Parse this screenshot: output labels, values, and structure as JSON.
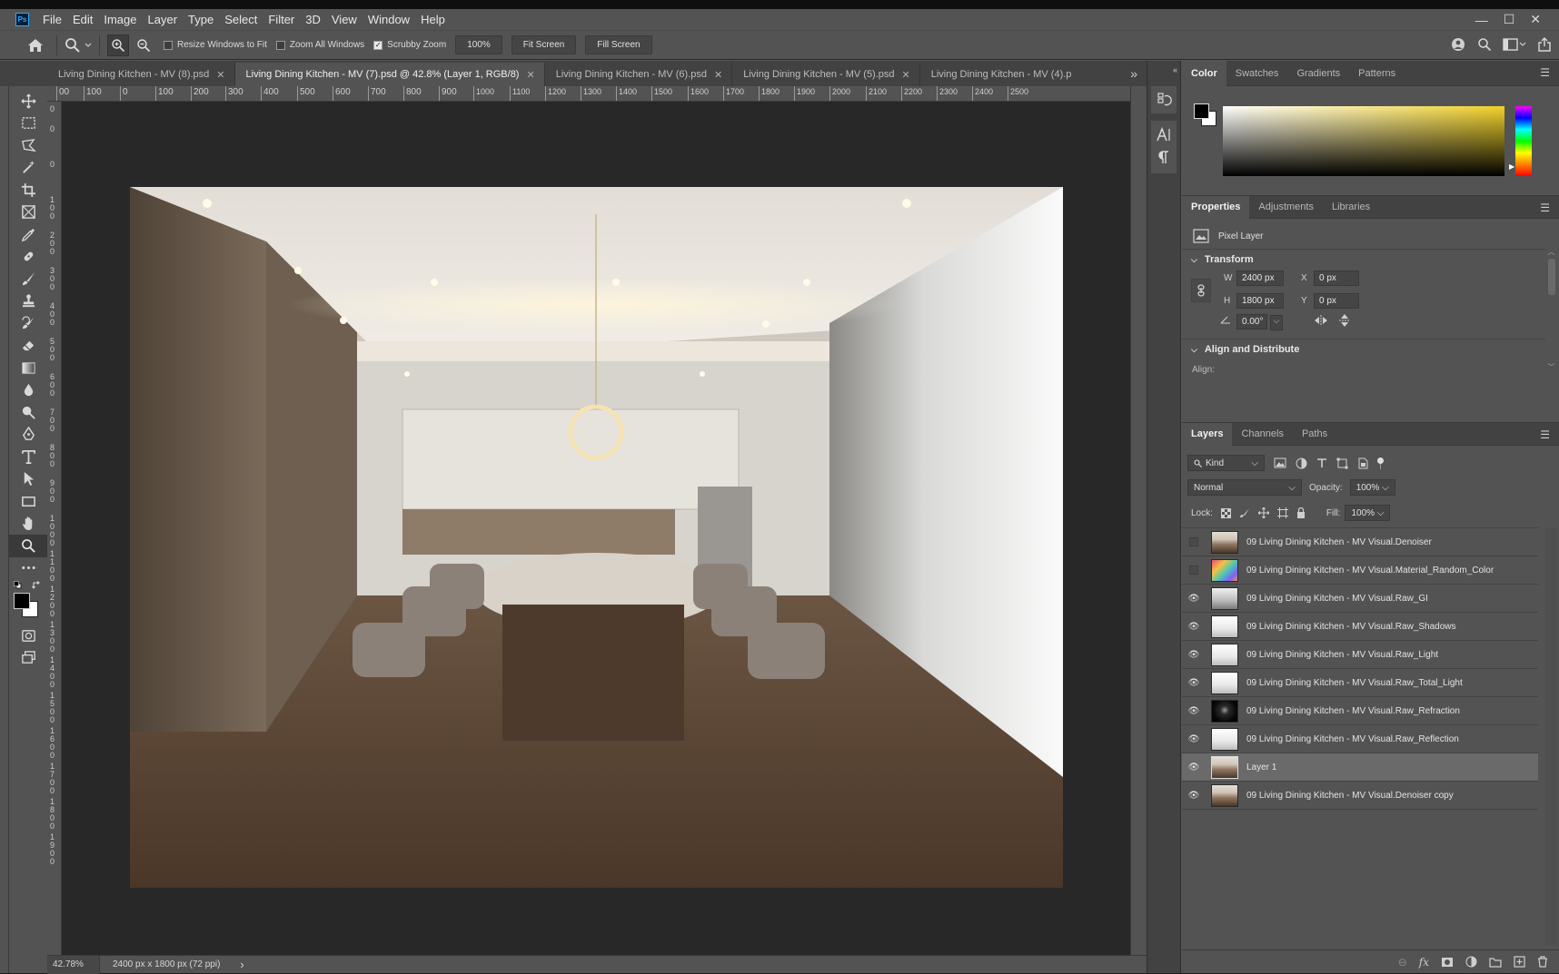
{
  "app": {
    "logo": "Ps",
    "menu": [
      "File",
      "Edit",
      "Image",
      "Layer",
      "Type",
      "Select",
      "Filter",
      "3D",
      "View",
      "Window",
      "Help"
    ],
    "window_controls": {
      "minimize": "—",
      "maximize": "☐",
      "close": "✕"
    }
  },
  "options_bar": {
    "resize_windows_label": "Resize Windows to Fit",
    "resize_windows_checked": false,
    "zoom_all_label": "Zoom All Windows",
    "zoom_all_checked": false,
    "scrubby_zoom_label": "Scrubby Zoom",
    "scrubby_zoom_checked": true,
    "zoom_percent": "100%",
    "fit_screen": "Fit Screen",
    "fill_screen": "Fill Screen"
  },
  "tabs": [
    {
      "label": "Living Dining Kitchen - MV (8).psd",
      "active": false,
      "closable": true
    },
    {
      "label": "Living Dining Kitchen - MV (7).psd @ 42.8% (Layer 1, RGB/8)",
      "active": true,
      "closable": true
    },
    {
      "label": "Living Dining Kitchen - MV (6).psd",
      "active": false,
      "closable": true
    },
    {
      "label": "Living Dining Kitchen - MV (5).psd",
      "active": false,
      "closable": true
    },
    {
      "label": "Living Dining Kitchen - MV (4).p",
      "active": false,
      "closable": false
    }
  ],
  "tabs_overflow": "»",
  "ruler": {
    "h_ticks": [
      "00",
      "100",
      "0",
      "100",
      "200",
      "300",
      "400",
      "500",
      "600",
      "700",
      "800",
      "900",
      "1000",
      "1100",
      "1200",
      "1300",
      "1400",
      "1500",
      "1600",
      "1700",
      "1800",
      "1900",
      "2000",
      "2100",
      "2200",
      "2300",
      "2400",
      "2500"
    ],
    "v_ticks": [
      "0",
      "0",
      "0",
      "100",
      "200",
      "300",
      "400",
      "500",
      "600",
      "700",
      "800",
      "900",
      "1000",
      "1100",
      "1200",
      "1300",
      "1400",
      "1500",
      "1600",
      "1700",
      "1800",
      "1900"
    ]
  },
  "status": {
    "zoom": "42.78%",
    "doc_size": "2400 px x 1800 px (72 ppi)",
    "arrow": "›"
  },
  "color_panel": {
    "tabs": [
      "Color",
      "Swatches",
      "Gradients",
      "Patterns"
    ],
    "active": "Color",
    "foreground": "#000000",
    "background": "#ffffff",
    "hue": "#f7e27a"
  },
  "properties_panel": {
    "tabs": [
      "Properties",
      "Adjustments",
      "Libraries"
    ],
    "active": "Properties",
    "layer_type": "Pixel Layer",
    "transform_title": "Transform",
    "w_label": "W",
    "w_value": "2400 px",
    "h_label": "H",
    "h_value": "1800 px",
    "x_label": "X",
    "x_value": "0 px",
    "y_label": "Y",
    "y_value": "0 px",
    "angle_value": "0.00°",
    "align_title": "Align and Distribute",
    "align_label": "Align:"
  },
  "layers_panel": {
    "tabs": [
      "Layers",
      "Channels",
      "Paths"
    ],
    "active": "Layers",
    "filter_kind": "Kind",
    "blend_mode": "Normal",
    "opacity_label": "Opacity:",
    "opacity_value": "100%",
    "lock_label": "Lock:",
    "fill_label": "Fill:",
    "fill_value": "100%",
    "layers": [
      {
        "name": "09 Living Dining Kitchen - MV Visual.Denoiser",
        "visible": false,
        "selected": false,
        "thumb": "render"
      },
      {
        "name": "09 Living Dining Kitchen - MV Visual.Material_Random_Color",
        "visible": false,
        "selected": false,
        "thumb": "color"
      },
      {
        "name": "09 Living Dining Kitchen - MV Visual.Raw_GI",
        "visible": true,
        "selected": false,
        "thumb": "light"
      },
      {
        "name": "09 Living Dining Kitchen - MV Visual.Raw_Shadows",
        "visible": true,
        "selected": false,
        "thumb": "white"
      },
      {
        "name": "09 Living Dining Kitchen - MV Visual.Raw_Light",
        "visible": true,
        "selected": false,
        "thumb": "white"
      },
      {
        "name": "09 Living Dining Kitchen - MV Visual.Raw_Total_Light",
        "visible": true,
        "selected": false,
        "thumb": "white"
      },
      {
        "name": "09 Living Dining Kitchen - MV Visual.Raw_Refraction",
        "visible": true,
        "selected": false,
        "thumb": "dark"
      },
      {
        "name": "09 Living Dining Kitchen - MV Visual.Raw_Reflection",
        "visible": true,
        "selected": false,
        "thumb": "white"
      },
      {
        "name": "Layer 1",
        "visible": true,
        "selected": true,
        "thumb": "render"
      },
      {
        "name": "09 Living Dining Kitchen - MV Visual.Denoiser copy",
        "visible": true,
        "selected": false,
        "thumb": "render"
      }
    ]
  },
  "colors": {
    "accent": "#31a8ff",
    "panel": "#535353",
    "panel_dark": "#424242",
    "canvas_bg": "#282828"
  }
}
